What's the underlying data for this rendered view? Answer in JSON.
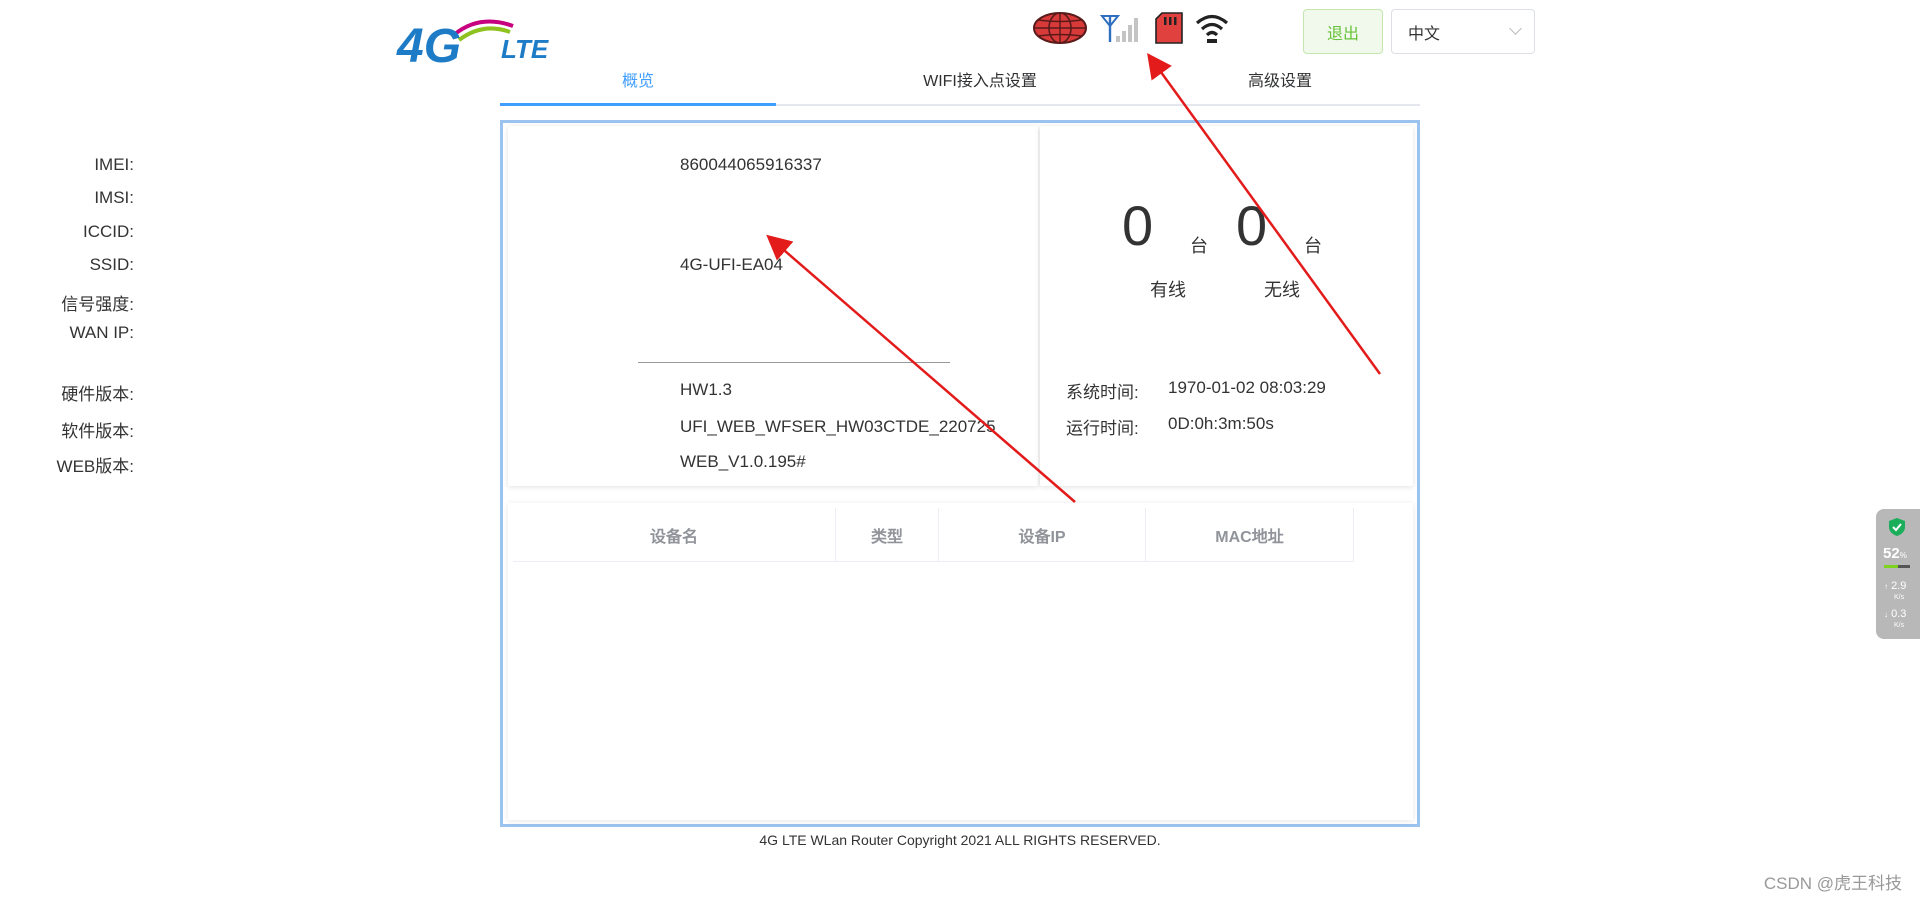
{
  "header": {
    "logo": {
      "main": "4G",
      "sub": "LTE"
    },
    "status_icons": [
      "globe-icon",
      "signal-antenna-icon",
      "sd-card-icon",
      "wifi-icon"
    ],
    "logout_label": "退出",
    "language": {
      "selected": "中文"
    }
  },
  "tabs": [
    {
      "label": "概览",
      "active": true
    },
    {
      "label": "WIFI接入点设置",
      "active": false
    },
    {
      "label": "高级设置",
      "active": false
    }
  ],
  "device_info": {
    "rows": [
      {
        "label": "IMEI:",
        "value": "860044065916337"
      },
      {
        "label": "IMSI:",
        "value": ""
      },
      {
        "label": "ICCID:",
        "value": ""
      },
      {
        "label": "SSID:",
        "value": "4G-UFI-EA04"
      },
      {
        "label": "信号强度:",
        "value": ""
      },
      {
        "label": "WAN IP:",
        "value": ""
      }
    ],
    "version_rows": [
      {
        "label": "硬件版本:",
        "value": "HW1.3"
      },
      {
        "label": "软件版本:",
        "value": "UFI_WEB_WFSER_HW03CTDE_220725"
      },
      {
        "label": "WEB版本:",
        "value": "WEB_V1.0.195#"
      }
    ]
  },
  "connections": {
    "wired": {
      "count": "0",
      "unit": "台",
      "label": "有线"
    },
    "wireless": {
      "count": "0",
      "unit": "台",
      "label": "无线"
    }
  },
  "times": {
    "system_label": "系统时间:",
    "system_value": "1970-01-02 08:03:29",
    "uptime_label": "运行时间:",
    "uptime_value": "0D:0h:3m:50s"
  },
  "device_table": {
    "columns": [
      "设备名",
      "类型",
      "设备IP",
      "MAC地址"
    ]
  },
  "footer": "4G LTE WLan Router Copyright 2021 ALL RIGHTS RESERVED.",
  "side_widget": {
    "percent": "52",
    "percent_unit": "%",
    "upload": "2.9",
    "download": "0.3",
    "speed_unit": "K/s"
  },
  "watermark": "CSDN @虎王科技",
  "colors": {
    "accent": "#409eff",
    "frame": "#9cc3ef",
    "logout": "#67c23a",
    "arrow": "#e31b1b"
  }
}
